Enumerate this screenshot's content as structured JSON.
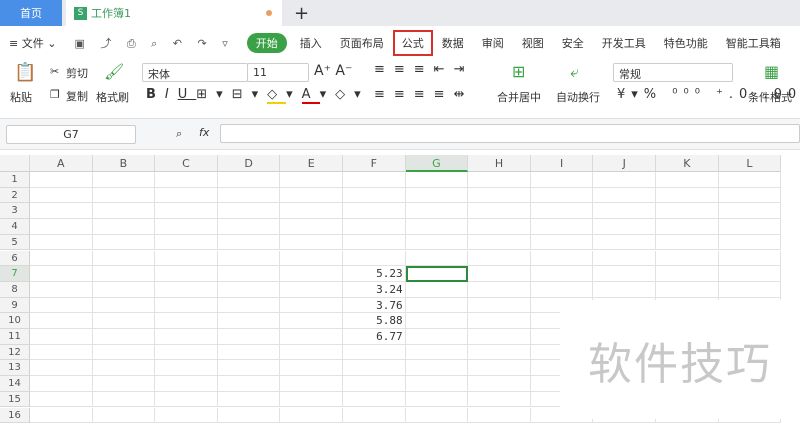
{
  "tabs": {
    "home": "首页",
    "doc": "工作簿1",
    "new": "+"
  },
  "menu": {
    "file": "≡ 文件 ⌄",
    "items": [
      "开始",
      "插入",
      "页面布局",
      "公式",
      "数据",
      "审阅",
      "视图",
      "安全",
      "开发工具",
      "特色功能",
      "智能工具箱"
    ]
  },
  "ribbon": {
    "paste": "粘贴",
    "cut": "剪切",
    "copy": "复制",
    "format_painter": "格式刷",
    "font": "宋体",
    "size": "11",
    "merge": "合并居中",
    "wrap": "自动换行",
    "number_format": "常规",
    "cond_format": "条件格式"
  },
  "formula_bar": {
    "name_box": "G7",
    "fx": "fx",
    "value": ""
  },
  "columns": [
    "A",
    "B",
    "C",
    "D",
    "E",
    "F",
    "G",
    "H",
    "I",
    "J",
    "K",
    "L"
  ],
  "rows": [
    "1",
    "2",
    "3",
    "4",
    "5",
    "6",
    "7",
    "8",
    "9",
    "10",
    "11",
    "12",
    "13",
    "14",
    "15",
    "16"
  ],
  "cells": {
    "F7": "5.23",
    "F8": "3.24",
    "F9": "3.76",
    "F10": "5.88",
    "F11": "6.77"
  },
  "selected": "G7",
  "watermark": "软件技巧",
  "colors": {
    "accent": "#3aa147",
    "highlight": "#d9302a"
  }
}
